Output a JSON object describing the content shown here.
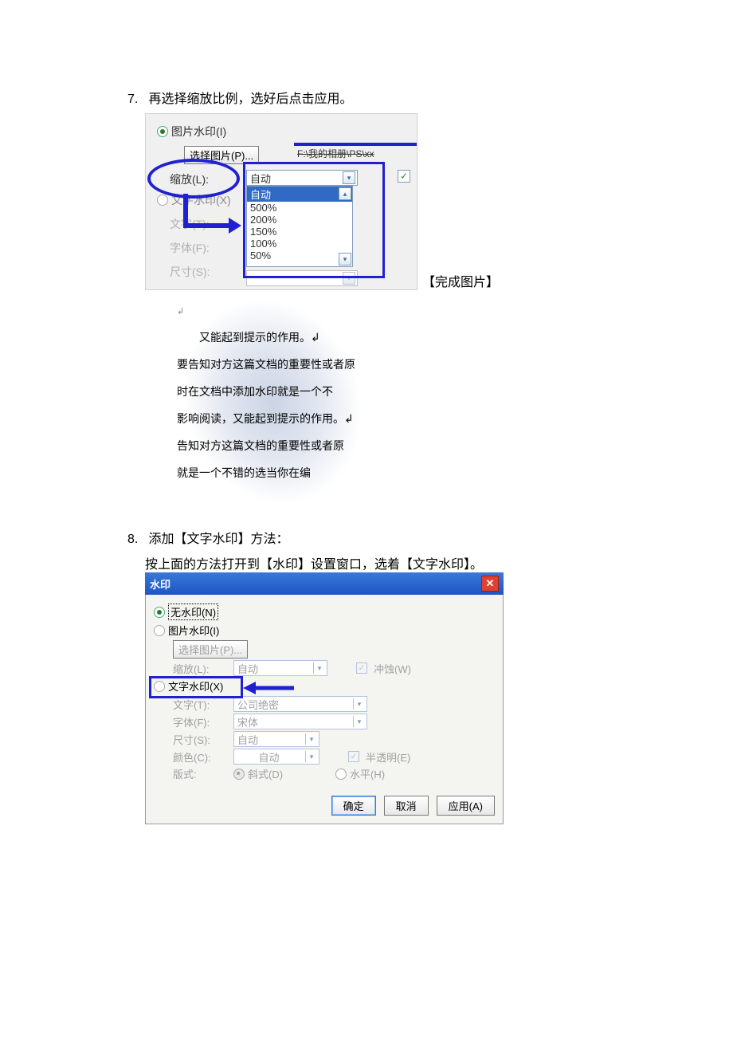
{
  "step7": {
    "num": "7.",
    "text": "再选择缩放比例，选好后点击应用。",
    "fig": {
      "radio_pic_watermark": "图片水印(I)",
      "btn_select_pic": "选择图片(P)...",
      "path_text": "F:\\我的相册\\PS\\xx",
      "label_scale": "缩放(L):",
      "radio_text_watermark_gray": "文字水印(X)",
      "label_text_gray": "文字(T):",
      "label_font_gray": "字体(F):",
      "label_size_gray": "尺寸(S):",
      "combo_value": "自动",
      "list_items": [
        "自动",
        "500%",
        "200%",
        "150%",
        "100%",
        "50%"
      ]
    },
    "caption": "【完成图片】"
  },
  "mid_paragraph": {
    "lines": [
      "↲",
      "　　又能起到提示的作用。↲",
      "要告知对方这篇文档的重要性或者原",
      "时在文档中添加水印就是一个不",
      "影响阅读，又能起到提示的作用。↲",
      "告知对方这篇文档的重要性或者原",
      "就是一个不错的选当你在编"
    ]
  },
  "step8": {
    "num": "8.",
    "text": "添加【文字水印】方法：",
    "sub": "按上面的方法打开到【水印】设置窗口，选着【文字水印】。",
    "dlg": {
      "title": "水印",
      "opt_none": "无水印(N)",
      "opt_pic": "图片水印(I)",
      "btn_select_pic": "选择图片(P)...",
      "label_scale": "缩放(L):",
      "scale_val": "自动",
      "chk_washout": "冲蚀(W)",
      "opt_text": "文字水印(X)",
      "label_text": "文字(T):",
      "text_val": "公司绝密",
      "label_font": "字体(F):",
      "font_val": "宋体",
      "label_size": "尺寸(S):",
      "size_val": "自动",
      "label_color": "颜色(C):",
      "color_val": "自动",
      "chk_semi": "半透明(E)",
      "label_layout": "版式:",
      "layout_diag": "斜式(D)",
      "layout_horiz": "水平(H)",
      "btn_ok": "确定",
      "btn_cancel": "取消",
      "btn_apply": "应用(A)"
    }
  }
}
